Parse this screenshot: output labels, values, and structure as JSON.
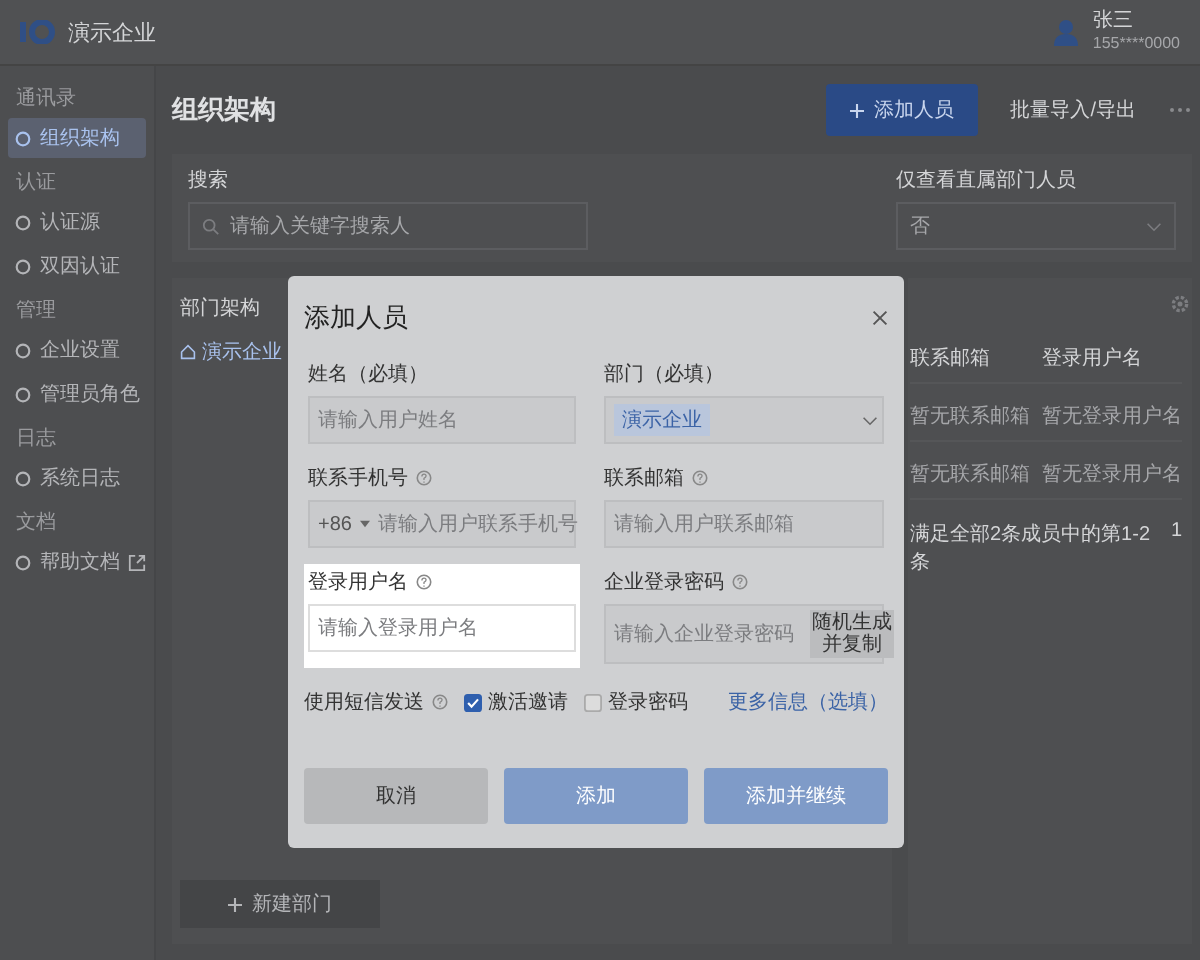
{
  "app_bar": {
    "logo_text": "演示企业",
    "user": {
      "name": "张三",
      "phone": "155****0000"
    }
  },
  "sidebar": [
    {
      "group": "通讯录",
      "items": [
        {
          "label": "组织架构",
          "selected": true,
          "external": false
        }
      ]
    },
    {
      "group": "认证",
      "items": [
        {
          "label": "认证源",
          "selected": false,
          "external": false
        },
        {
          "label": "双因认证",
          "selected": false,
          "external": false
        }
      ]
    },
    {
      "group": "管理",
      "items": [
        {
          "label": "企业设置",
          "selected": false,
          "external": false
        },
        {
          "label": "管理员角色",
          "selected": false,
          "external": false
        }
      ]
    },
    {
      "group": "日志",
      "items": [
        {
          "label": "系统日志",
          "selected": false,
          "external": false
        }
      ]
    },
    {
      "group": "文档",
      "items": [
        {
          "label": "帮助文档",
          "selected": false,
          "external": true
        }
      ]
    }
  ],
  "page": {
    "title": "组织架构",
    "actions": [
      {
        "label": "添加人员",
        "kind": "primary"
      },
      {
        "label": "批量导入/导出",
        "kind": "text"
      },
      {
        "kind": "more"
      }
    ],
    "filters": [
      {
        "label": "搜索",
        "kind": "search",
        "placeholder": "请输入关键字搜索人"
      },
      {
        "label": "仅查看直属部门人员",
        "kind": "select",
        "value": "否"
      }
    ],
    "departments": {
      "title": "部门架构",
      "tree": [
        {
          "label": "演示企业",
          "selected": true
        }
      ],
      "new_button": "新建部门"
    },
    "table": {
      "columns": [
        "联系邮箱",
        "登录用户名"
      ],
      "rows": [
        [
          "暂无联系邮箱",
          "暂无登录用户名"
        ],
        [
          "暂无联系邮箱",
          "暂无登录用户名"
        ]
      ],
      "summary": "满足全部2条成员中的第1-2条",
      "page": "1"
    }
  },
  "dialog": {
    "title": "添加人员",
    "fields": [
      {
        "label": "姓名（必填）",
        "kind": "text",
        "placeholder": "请输入用户姓名",
        "help": false,
        "highlighted": false
      },
      {
        "label": "部门（必填）",
        "kind": "select",
        "tag": "演示企业",
        "help": false,
        "highlighted": false
      },
      {
        "label": "联系手机号",
        "kind": "phone",
        "prefix": "+86",
        "placeholder": "请输入用户联系手机号",
        "help": true,
        "highlighted": false
      },
      {
        "label": "联系邮箱",
        "kind": "text",
        "placeholder": "请输入用户联系邮箱",
        "help": true,
        "highlighted": false
      },
      {
        "label": "登录用户名",
        "kind": "text",
        "placeholder": "请输入登录用户名",
        "help": true,
        "highlighted": true
      },
      {
        "label": "企业登录密码",
        "kind": "password",
        "placeholder": "请输入企业登录密码",
        "button": "随机生成并复制",
        "help": true,
        "highlighted": false
      }
    ],
    "sms": {
      "label": "使用短信发送",
      "help": true,
      "options": [
        {
          "label": "激活邀请",
          "checked": true
        },
        {
          "label": "登录密码",
          "checked": false
        }
      ]
    },
    "more_link": "更多信息（选填）",
    "buttons": [
      {
        "label": "取消",
        "kind": "secondary",
        "disabled": false
      },
      {
        "label": "添加",
        "kind": "primary",
        "disabled": true
      },
      {
        "label": "添加并继续",
        "kind": "primary",
        "disabled": true
      }
    ]
  }
}
